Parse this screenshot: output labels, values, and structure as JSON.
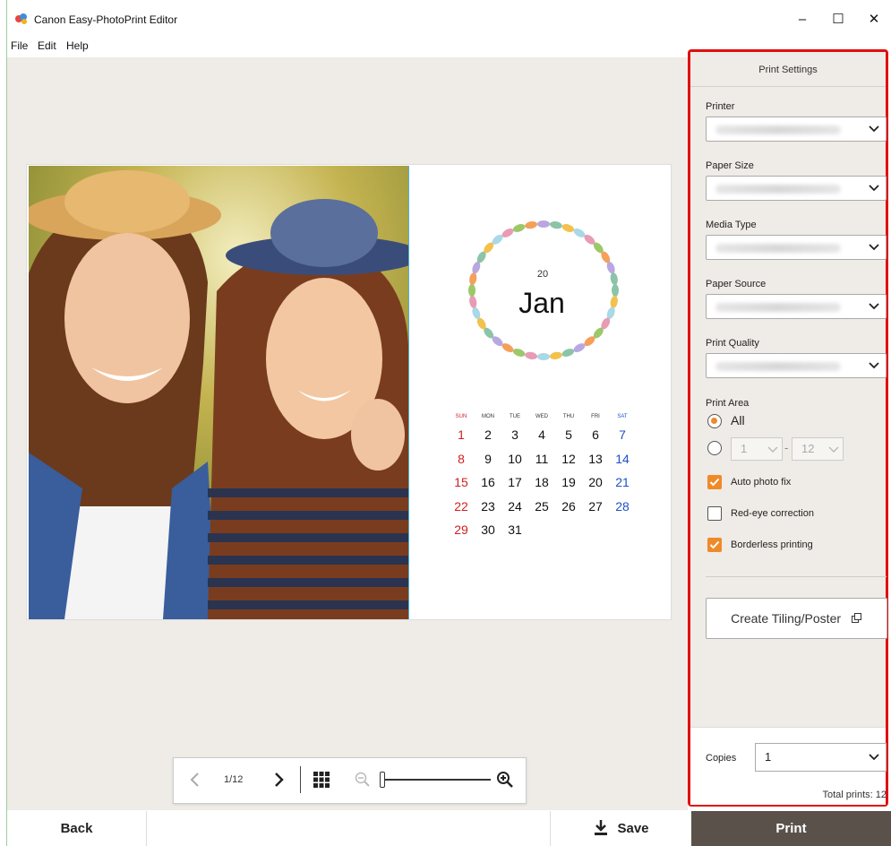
{
  "window": {
    "title": "Canon Easy-PhotoPrint Editor",
    "controls": {
      "minimize": "–",
      "maximize": "☐",
      "close": "✕"
    }
  },
  "menu": [
    "File",
    "Edit",
    "Help"
  ],
  "calendar": {
    "year": "20",
    "month": "Jan",
    "weekdays": [
      "SUN",
      "MON",
      "TUE",
      "WED",
      "THU",
      "FRI",
      "SAT"
    ],
    "weeks": [
      [
        "1",
        "2",
        "3",
        "4",
        "5",
        "6",
        "7"
      ],
      [
        "8",
        "9",
        "10",
        "11",
        "12",
        "13",
        "14"
      ],
      [
        "15",
        "16",
        "17",
        "18",
        "19",
        "20",
        "21"
      ],
      [
        "22",
        "23",
        "24",
        "25",
        "26",
        "27",
        "28"
      ],
      [
        "29",
        "30",
        "31",
        "",
        "",
        "",
        ""
      ]
    ]
  },
  "navigator": {
    "page_indicator": "1/12",
    "zoom_level": 0.0
  },
  "bottom_bar": {
    "back_label": "Back",
    "save_label": "Save",
    "print_label": "Print"
  },
  "print_settings": {
    "header": "Print Settings",
    "printer_label": "Printer",
    "paper_size_label": "Paper Size",
    "media_type_label": "Media Type",
    "paper_source_label": "Paper Source",
    "print_quality_label": "Print Quality",
    "print_area_label": "Print Area",
    "print_area_all": "All",
    "range_from": "1",
    "range_sep": "-",
    "range_to": "12",
    "auto_photo_fix": {
      "label": "Auto photo fix",
      "checked": true
    },
    "red_eye": {
      "label": "Red-eye correction",
      "checked": false
    },
    "borderless": {
      "label": "Borderless printing",
      "checked": true
    },
    "tiling_button": "Create Tiling/Poster",
    "copies_label": "Copies",
    "copies_value": "1",
    "total_prints": "Total prints: 12"
  },
  "colors": {
    "accent": "#ef8a29",
    "print_button": "#5a514a",
    "highlight_border": "#e01010"
  }
}
